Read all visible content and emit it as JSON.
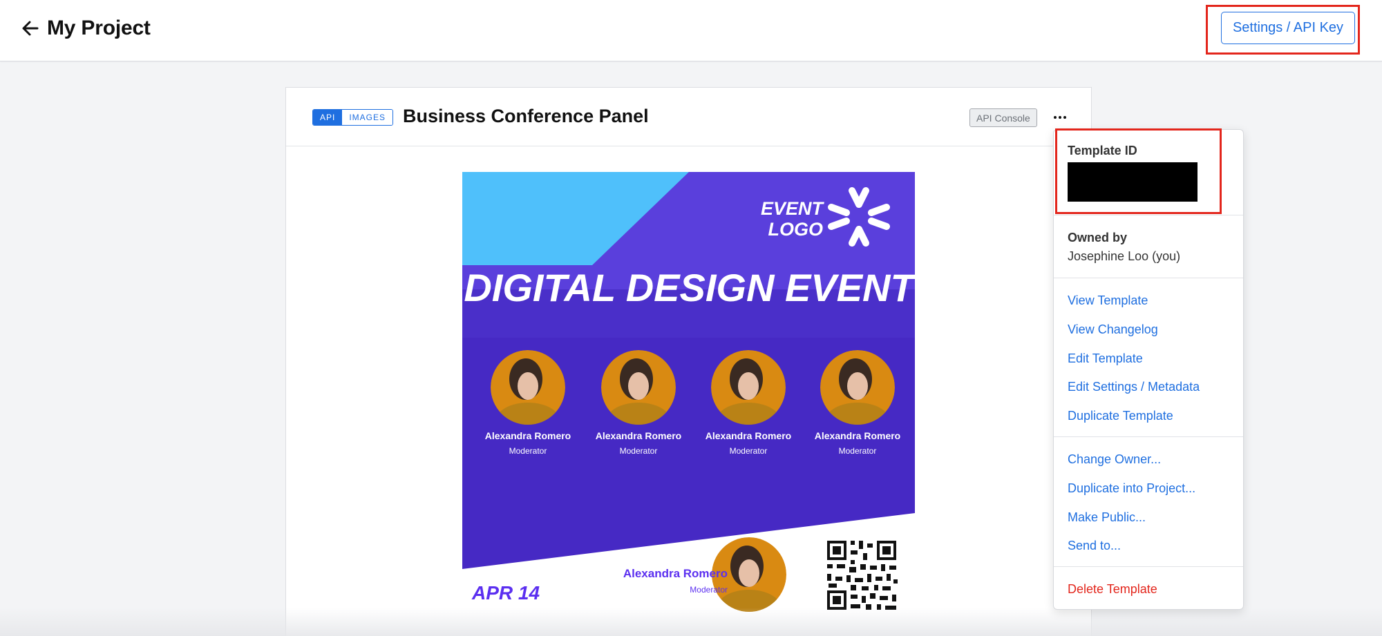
{
  "header": {
    "back_label": "My Project",
    "settings_label": "Settings / API Key"
  },
  "card": {
    "badge_api": "API",
    "badge_images": "IMAGES",
    "title": "Business Conference Panel",
    "api_console_label": "API Console"
  },
  "preview": {
    "logo_line1": "EVENT",
    "logo_line2": "LOGO",
    "headline": "DIGITAL DESIGN EVENT",
    "speakers": [
      {
        "name": "Alexandra Romero",
        "role": "Moderator"
      },
      {
        "name": "Alexandra Romero",
        "role": "Moderator"
      },
      {
        "name": "Alexandra Romero",
        "role": "Moderator"
      },
      {
        "name": "Alexandra Romero",
        "role": "Moderator"
      }
    ],
    "host": {
      "name": "Alexandra Romero",
      "role": "Moderator"
    },
    "date": "APR 14"
  },
  "menu": {
    "template_id_label": "Template ID",
    "owned_by_label": "Owned by",
    "owned_by_value": "Josephine Loo (you)",
    "group1": [
      "View Template",
      "View Changelog",
      "Edit Template",
      "Edit Settings / Metadata",
      "Duplicate Template"
    ],
    "group2": [
      "Change Owner...",
      "Duplicate into Project...",
      "Make Public...",
      "Send to..."
    ],
    "delete_label": "Delete Template"
  },
  "colors": {
    "accent": "#1f6fe0",
    "highlight": "#e3261c",
    "poster_purple": "#4a2fc9",
    "poster_light_blue": "#4fc0fb",
    "poster_date": "#5b2ff0"
  }
}
